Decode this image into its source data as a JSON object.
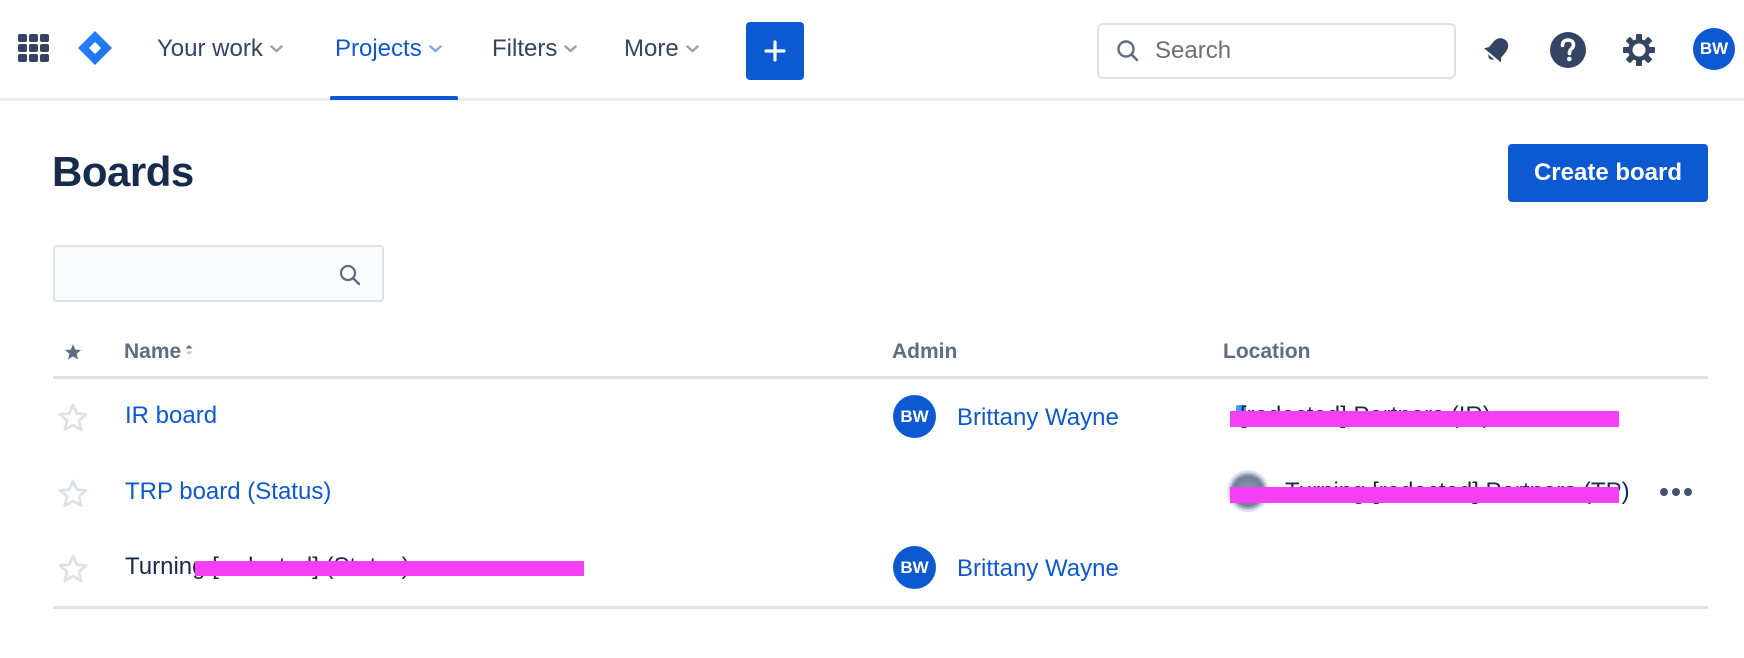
{
  "nav": {
    "app_switcher_icon": "grid-icon",
    "logo_icon": "jira-logo-icon",
    "items": [
      {
        "label": "Your work",
        "active": false
      },
      {
        "label": "Projects",
        "active": true
      },
      {
        "label": "Filters",
        "active": false
      },
      {
        "label": "More",
        "active": false
      }
    ],
    "create_icon": "plus-icon",
    "search": {
      "placeholder": "Search",
      "value": ""
    },
    "notifications_icon": "bell-icon",
    "help_icon": "help-icon",
    "settings_icon": "gear-icon",
    "user_initials": "BW"
  },
  "page": {
    "title": "Boards",
    "create_button_label": "Create board",
    "filter": {
      "placeholder": "",
      "value": ""
    }
  },
  "table": {
    "columns": {
      "star_icon": "star-filled-icon",
      "name": "Name",
      "admin": "Admin",
      "location": "Location"
    },
    "sort": {
      "column": "Name",
      "direction": "ascending"
    },
    "rows": [
      {
        "starred": false,
        "name": "IR board",
        "name_is_link": true,
        "admin": {
          "initials": "BW",
          "name": "Brittany Wayne"
        },
        "location": "[redacted] Partners (IR)",
        "location_redacted": true,
        "has_actions": false
      },
      {
        "starred": false,
        "name": "TRP board (Status)",
        "name_is_link": true,
        "admin": null,
        "location": "Turning [redacted] Partners (TP)",
        "location_redacted": true,
        "has_actions": true,
        "actions_icon": "more-horizontal-icon"
      },
      {
        "starred": false,
        "name": "Turning [redacted] (Status)",
        "name_is_link": false,
        "name_redacted": true,
        "admin": {
          "initials": "BW",
          "name": "Brittany Wayne"
        },
        "location": "",
        "has_actions": false
      }
    ]
  },
  "colors": {
    "brand_blue": "#0c59d2",
    "text_dark": "#172b4d",
    "text_subtle": "#5e6c84",
    "divider": "#dfe1e6",
    "redaction": "#f53ff5"
  }
}
